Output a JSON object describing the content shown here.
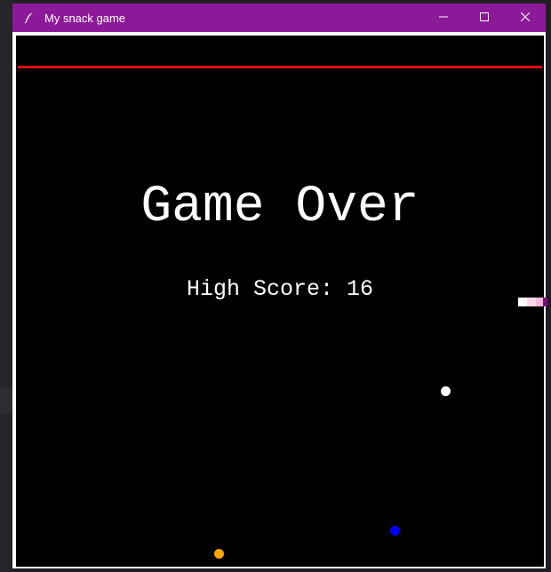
{
  "window": {
    "title": "My snack game",
    "title_bar_color": "#8c1a98",
    "icon": "feather-icon",
    "controls": [
      "minimize-icon",
      "maximize-icon",
      "close-icon"
    ]
  },
  "game": {
    "background_color": "#000000",
    "boundary_line_color": "#e01010",
    "message": "Game Over",
    "high_score_label": "High Score: 16",
    "high_score": 16,
    "food_items": [
      {
        "color": "#ffffff"
      },
      {
        "color": "#0000ff"
      },
      {
        "color": "#ffa500"
      }
    ],
    "snake_colors": [
      "#ffffff",
      "#ffd6e8",
      "#f3b6d6",
      "#7a0f7a"
    ]
  }
}
